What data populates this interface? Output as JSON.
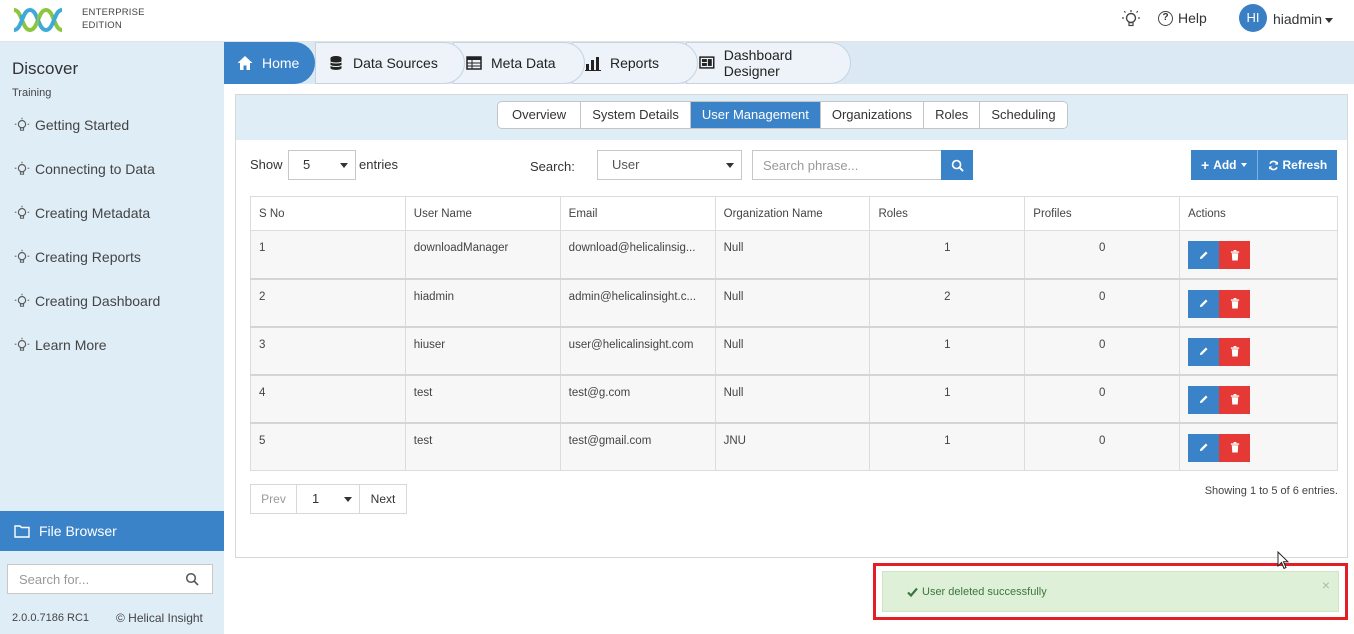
{
  "header": {
    "edition_line1": "ENTERPRISE",
    "edition_line2": "EDITION",
    "help_label": "Help",
    "avatar_initials": "HI",
    "username": "hiadmin"
  },
  "sidebar": {
    "title": "Discover",
    "subtitle": "Training",
    "items": [
      {
        "label": "Getting Started"
      },
      {
        "label": "Connecting to Data"
      },
      {
        "label": "Creating Metadata"
      },
      {
        "label": "Creating Reports"
      },
      {
        "label": "Creating Dashboard"
      },
      {
        "label": "Learn More"
      }
    ],
    "file_browser_label": "File Browser",
    "search_placeholder": "Search for...",
    "version": "2.0.0.7186 RC1",
    "copyright": "© Helical Insight"
  },
  "nav": {
    "tabs": [
      {
        "label": "Home",
        "icon": "home-icon"
      },
      {
        "label": "Data Sources",
        "icon": "database-icon"
      },
      {
        "label": "Meta Data",
        "icon": "table-icon"
      },
      {
        "label": "Reports",
        "icon": "bar-chart-icon"
      },
      {
        "label": "Dashboard Designer",
        "icon": "dashboard-icon"
      }
    ]
  },
  "subtabs": [
    {
      "label": "Overview"
    },
    {
      "label": "System Details"
    },
    {
      "label": "User Management"
    },
    {
      "label": "Organizations"
    },
    {
      "label": "Roles"
    },
    {
      "label": "Scheduling"
    }
  ],
  "toolbar": {
    "show_label": "Show",
    "entries_value": "5",
    "entries_label": "entries",
    "search_label": "Search:",
    "search_type": "User",
    "search_placeholder": "Search phrase...",
    "add_label": "Add",
    "refresh_label": "Refresh"
  },
  "table": {
    "columns": [
      "S No",
      "User Name",
      "Email",
      "Organization Name",
      "Roles",
      "Profiles",
      "Actions"
    ],
    "rows": [
      {
        "sno": "1",
        "username": "downloadManager",
        "email": "download@helicalinsig...",
        "org": "Null",
        "roles": "1",
        "profiles": "0"
      },
      {
        "sno": "2",
        "username": "hiadmin",
        "email": "admin@helicalinsight.c...",
        "org": "Null",
        "roles": "2",
        "profiles": "0"
      },
      {
        "sno": "3",
        "username": "hiuser",
        "email": "user@helicalinsight.com",
        "org": "Null",
        "roles": "1",
        "profiles": "0"
      },
      {
        "sno": "4",
        "username": "test",
        "email": "test@g.com",
        "org": "Null",
        "roles": "1",
        "profiles": "0"
      },
      {
        "sno": "5",
        "username": "test",
        "email": "test@gmail.com",
        "org": "JNU",
        "roles": "1",
        "profiles": "0"
      }
    ]
  },
  "pager": {
    "prev_label": "Prev",
    "page_value": "1",
    "next_label": "Next",
    "showing_text": "Showing 1 to 5 of 6 entries."
  },
  "toast": {
    "message": "User deleted successfully",
    "close_glyph": "×"
  },
  "colors": {
    "accent": "#3a83c8",
    "danger": "#e53935",
    "sidebar_bg": "#dfedf7",
    "success_bg": "#dff0d8",
    "highlight_frame": "#e31e24"
  }
}
